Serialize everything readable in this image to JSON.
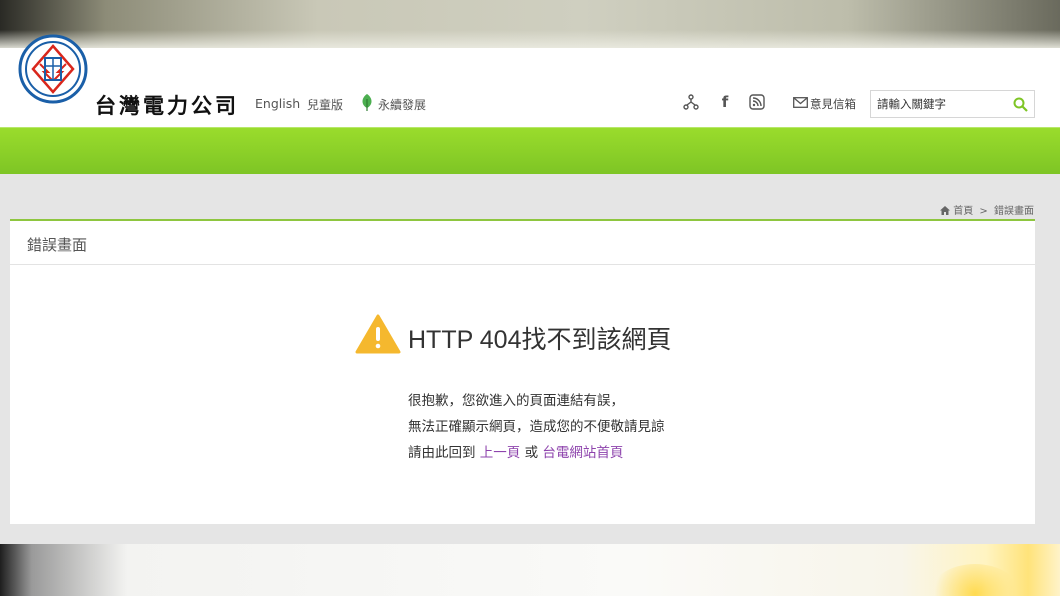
{
  "header": {
    "brand_name": "台灣電力公司",
    "links": {
      "english": "English",
      "kids": "兒童版",
      "sustainability": "永續發展"
    },
    "social_icons": [
      "sitemap-icon",
      "facebook-icon",
      "rss-icon"
    ],
    "facebook_glyph": "f",
    "feedback": "意見信箱",
    "search": {
      "placeholder": "請輸入關鍵字",
      "value": ""
    }
  },
  "breadcrumb": {
    "home": "首頁",
    "separator": ">",
    "current": "錯誤畫面"
  },
  "panel": {
    "title": "錯誤畫面",
    "error_title": "HTTP 404找不到該網頁",
    "message_line1": "很抱歉，您欲進入的頁面連結有誤，",
    "message_line2": "無法正確顯示網頁，造成您的不便敬請見諒",
    "message_line3_prefix": "請由此回到",
    "back_link": "上一頁",
    "or": "或",
    "home_link": "台電網站首頁"
  },
  "colors": {
    "brand_green": "#8ec63f",
    "band_green": "#7ec525",
    "link_purple": "#8e44ad",
    "warning_yellow": "#f5b82e",
    "logo_blue": "#1a5fa8",
    "logo_red": "#d9261c"
  }
}
